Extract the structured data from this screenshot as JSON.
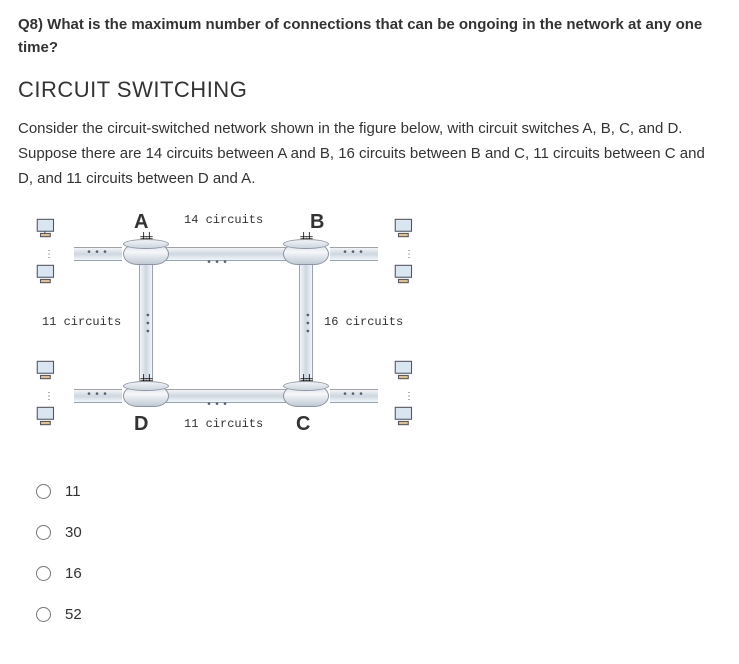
{
  "question": {
    "title": "Q8) What is the maximum number of connections that can be ongoing in the network at any one time?",
    "heading": "CIRCUIT SWITCHING",
    "description": "Consider the circuit-switched network shown in the figure below, with circuit switches A, B, C, and D. Suppose there are 14 circuits between A and B, 16 circuits between B and C, 11 circuits between C and D, and 11 circuits between D and A."
  },
  "figure": {
    "nodes": {
      "A": "A",
      "B": "B",
      "C": "C",
      "D": "D"
    },
    "edges": {
      "AB": "14 circuits",
      "BC": "16 circuits",
      "CD": "11 circuits",
      "DA": "11 circuits"
    }
  },
  "options": {
    "o1": "11",
    "o2": "30",
    "o3": "16",
    "o4": "52"
  }
}
